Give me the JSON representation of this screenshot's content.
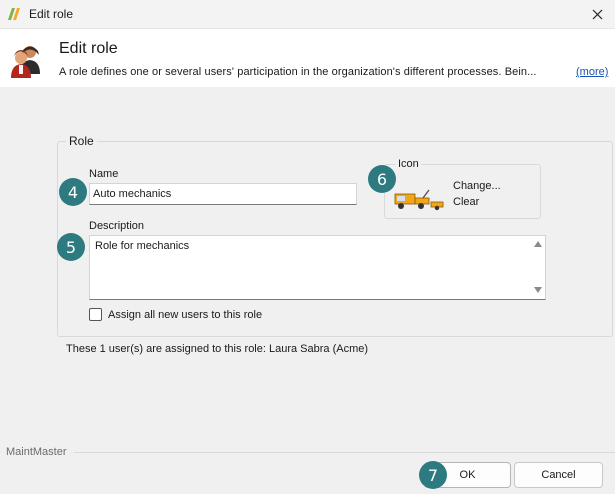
{
  "window": {
    "title": "Edit role",
    "close_glyph": "✕",
    "app_icon": "maintmaster-logo-icon"
  },
  "header": {
    "title": "Edit role",
    "description": "A role defines one or several users' participation in the organization's different processes. Bein...",
    "more_link": "(more)",
    "icon": "users-icon"
  },
  "form": {
    "group_label": "Role",
    "name_label": "Name",
    "name_value": "Auto mechanics",
    "description_label": "Description",
    "description_value": "Role for mechanics",
    "icon_label": "Icon",
    "icon_image": "tow-truck-icon",
    "change_link": "Change...",
    "clear_link": "Clear",
    "checkbox_label": "Assign all new users to this role",
    "checkbox_checked": false,
    "assigned_text": "These 1 user(s) are assigned to this role: Laura Sabra (Acme)"
  },
  "footer": {
    "brand": "MaintMaster",
    "ok_label": "OK",
    "cancel_label": "Cancel"
  },
  "callouts": {
    "name": "4",
    "description": "5",
    "icon": "6",
    "ok": "7",
    "color": "#2d7b80"
  }
}
